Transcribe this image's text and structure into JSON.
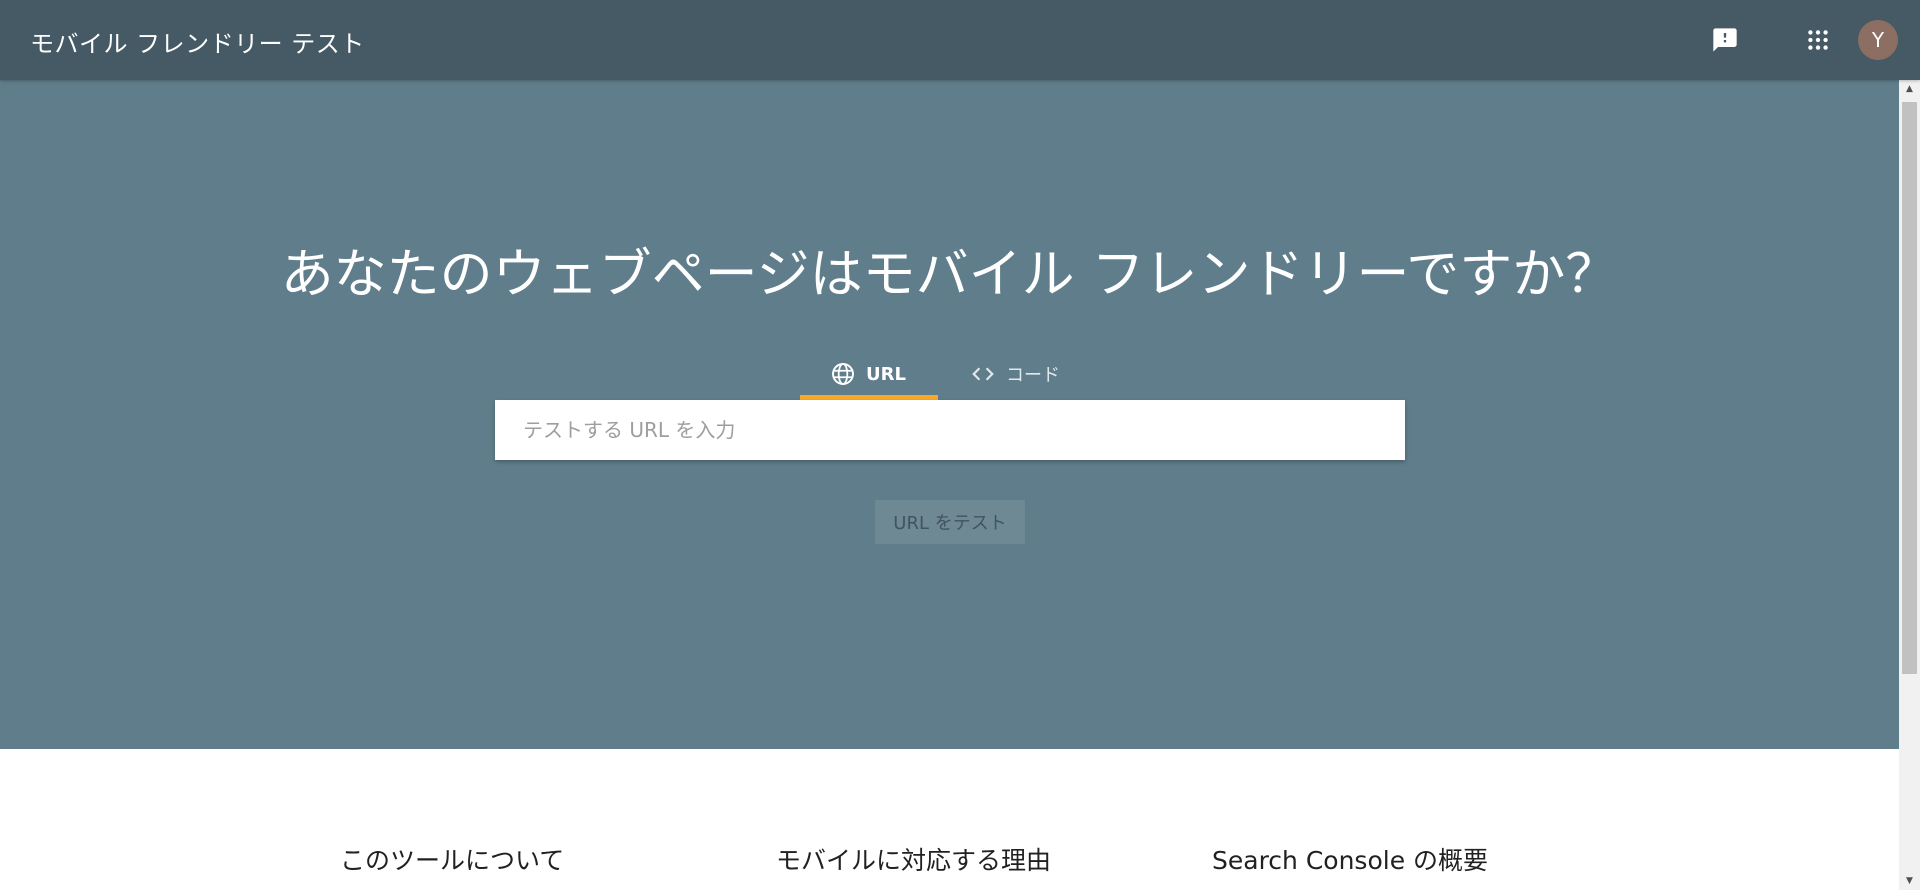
{
  "header": {
    "title": "モバイル フレンドリー テスト",
    "feedback_icon": "feedback-icon",
    "apps_icon": "apps-grid-icon",
    "avatar_letter": "Y",
    "avatar_color": "#8d6e63",
    "background_color": "#455a64"
  },
  "hero": {
    "heading": "あなたのウェブページはモバイル フレンドリーですか？",
    "background_color": "#607d8b",
    "tabs": [
      {
        "label": "URL",
        "icon": "globe-icon",
        "selected": true
      },
      {
        "label": "コード",
        "icon": "code-icon",
        "selected": false
      }
    ],
    "tab_indicator_color": "#f9a825",
    "url_input": {
      "value": "",
      "placeholder": "テストする URL を入力"
    },
    "test_button": {
      "label": "URL をテスト",
      "enabled": false
    }
  },
  "info": {
    "columns": [
      {
        "title": "このツールについて"
      },
      {
        "title": "モバイルに対応する理由"
      },
      {
        "title": "Search Console の概要"
      }
    ]
  }
}
